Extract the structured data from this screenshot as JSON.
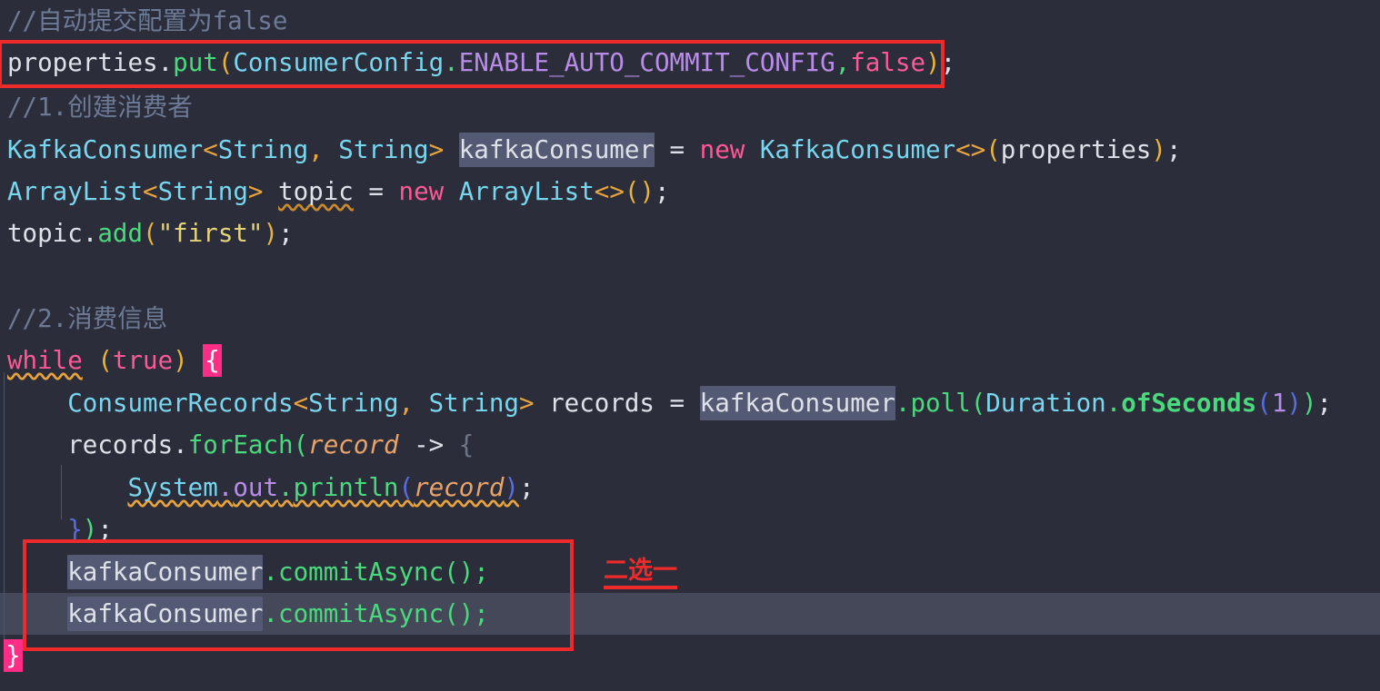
{
  "editor": {
    "background_color": "#2b2d3a",
    "current_line_color": "#454859",
    "language": "java",
    "identifier_highlight": "kafkaConsumer",
    "brace_highlight_color": "#ff2d86"
  },
  "code": {
    "line1_comment": "//自动提交配置为false",
    "line2": {
      "obj": "properties",
      "dot1": ".",
      "method": "put",
      "paren_open": "(",
      "class": "ConsumerConfig",
      "dot2": ".",
      "const": "ENABLE_AUTO_COMMIT_CONFIG",
      "comma": ",",
      "value": "false",
      "paren_close": ")",
      "semi": ";"
    },
    "line3_comment": "//1.创建消费者",
    "line4": {
      "type": "KafkaConsumer",
      "lt": "<",
      "generic1": "String",
      "sep": ", ",
      "generic2": "String",
      "gt": ">",
      "var": "kafkaConsumer",
      "eq": " = ",
      "new": "new",
      "ctor": "KafkaConsumer",
      "diamond": "<>",
      "paren_open": "(",
      "arg": "properties",
      "paren_close": ")",
      "semi": ";"
    },
    "line5": {
      "type": "ArrayList",
      "lt": "<",
      "generic": "String",
      "gt": ">",
      "var": "topic",
      "eq": " = ",
      "new": "new",
      "ctor": "ArrayList",
      "diamond": "<>",
      "parens": "()",
      "semi": ";"
    },
    "line6": {
      "obj": "topic",
      "dot": ".",
      "method": "add",
      "paren_open": "(",
      "string": "\"first\"",
      "paren_close": ")",
      "semi": ";"
    },
    "line8_comment": "//2.消费信息",
    "line9": {
      "keyword": "while",
      "space": " ",
      "paren_open": "(",
      "cond": "true",
      "paren_close": ")",
      "space2": " ",
      "brace": "{"
    },
    "line10": {
      "type": "ConsumerRecords",
      "lt": "<",
      "generic1": "String",
      "sep": ", ",
      "generic2": "String",
      "gt": ">",
      "var": " records",
      "eq": " = ",
      "obj": "kafkaConsumer",
      "dot1": ".",
      "method": "poll",
      "paren_open": "(",
      "class": "Duration",
      "dot2": ".",
      "method2": "ofSeconds",
      "paren_open2": "(",
      "num": "1",
      "paren_close2": ")",
      "paren_close": ")",
      "semi": ";"
    },
    "line11": {
      "obj": "records",
      "dot": ".",
      "method": "forEach",
      "paren_open": "(",
      "param": "record",
      "arrow": " -> ",
      "brace": "{"
    },
    "line12": {
      "class": "System",
      "dot1": ".",
      "field": "out",
      "dot2": ".",
      "method": "println",
      "paren_open": "(",
      "param": "record",
      "paren_close": ")",
      "semi": ";"
    },
    "line13": {
      "brace": "}",
      "paren": ")",
      "semi": ";"
    },
    "line14": {
      "obj": "kafkaConsumer",
      "dot": ".",
      "method": "commitAsync",
      "parens": "()",
      "semi": ";"
    },
    "line15": {
      "obj": "kafkaConsumer",
      "dot": ".",
      "method": "commitAsync",
      "parens": "()",
      "semi": ";"
    },
    "line16": {
      "brace": "}"
    }
  },
  "annotations": {
    "box1_label": "properties-put-autocommit-box",
    "box2_label": "commit-async-choice-box",
    "note_text": "二选一",
    "note_color": "#ee2a2a"
  }
}
